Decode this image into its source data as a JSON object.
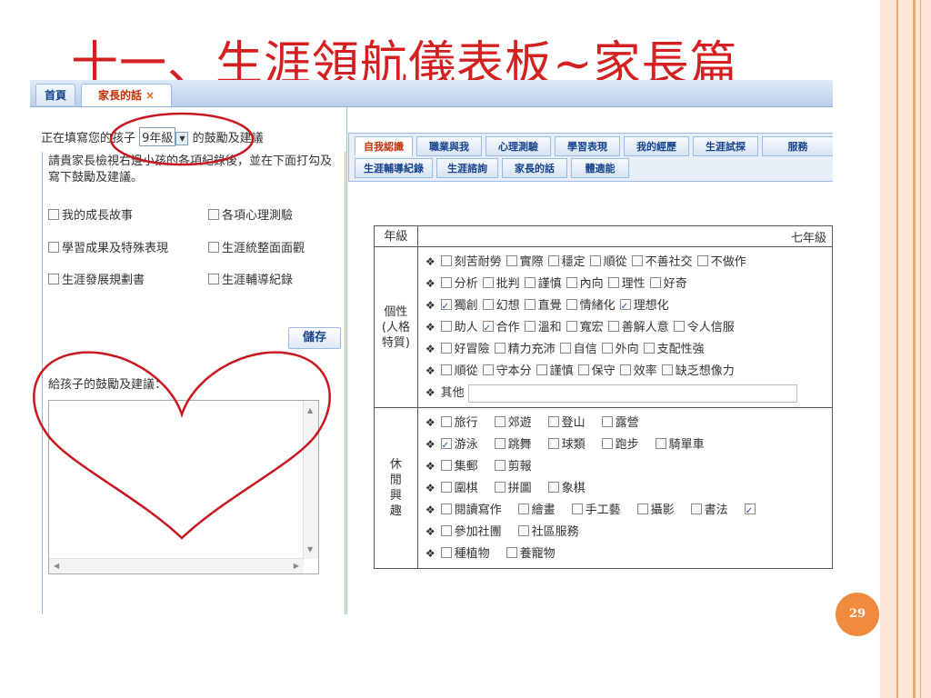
{
  "slide": {
    "title": "十一、生涯領航儀表板~家長篇",
    "page_number": "29"
  },
  "top_tabs": [
    {
      "label": "首頁",
      "active": false
    },
    {
      "label": "家長的話",
      "active": true,
      "close": "×"
    }
  ],
  "left": {
    "prefix": "正在填寫您的孩子",
    "grade": "9年級",
    "suffix": "的鼓勵及建議",
    "intro": "請貴家長檢視右邊小孩的各項紀錄後，並在下面打勾及寫下鼓勵及建議。",
    "options": [
      {
        "label": "我的成長故事"
      },
      {
        "label": "各項心理測驗"
      },
      {
        "label": "學習成果及特殊表現"
      },
      {
        "label": "生涯統整面面觀"
      },
      {
        "label": "生涯發展規劃書"
      },
      {
        "label": "生涯輔導紀錄"
      }
    ],
    "save_label": "儲存",
    "advice_label": "給孩子的鼓勵及建議："
  },
  "right": {
    "tabs_row1": [
      "自我認識",
      "職業與我",
      "心理測驗",
      "學習表現",
      "我的經歷",
      "生涯試探",
      "服務"
    ],
    "tabs_row2": [
      "生涯輔導紀錄",
      "生涯諮詢",
      "家長的話",
      "體適能"
    ],
    "table": {
      "grade_header": "年級",
      "grade_value": "七年級",
      "personality_label": "個性\n(人格\n特質)",
      "personality_rows": [
        [
          {
            "label": "刻苦耐勞",
            "checked": false
          },
          {
            "label": "實際",
            "checked": false
          },
          {
            "label": "穩定",
            "checked": false
          },
          {
            "label": "順從",
            "checked": false
          },
          {
            "label": "不善社交",
            "checked": false
          },
          {
            "label": "不做作",
            "checked": false
          }
        ],
        [
          {
            "label": "分析",
            "checked": false
          },
          {
            "label": "批判",
            "checked": false
          },
          {
            "label": "謹慎",
            "checked": false
          },
          {
            "label": "內向",
            "checked": false
          },
          {
            "label": "理性",
            "checked": false
          },
          {
            "label": "好奇",
            "checked": false
          }
        ],
        [
          {
            "label": "獨創",
            "checked": true
          },
          {
            "label": "幻想",
            "checked": false
          },
          {
            "label": "直覺",
            "checked": false
          },
          {
            "label": "情緒化",
            "checked": false
          },
          {
            "label": "理想化",
            "checked": true
          }
        ],
        [
          {
            "label": "助人",
            "checked": false
          },
          {
            "label": "合作",
            "checked": true
          },
          {
            "label": "溫和",
            "checked": false
          },
          {
            "label": "寬宏",
            "checked": false
          },
          {
            "label": "善解人意",
            "checked": false
          },
          {
            "label": "令人信服",
            "checked": false
          }
        ],
        [
          {
            "label": "好冒險",
            "checked": false
          },
          {
            "label": "精力充沛",
            "checked": false
          },
          {
            "label": "自信",
            "checked": false
          },
          {
            "label": "外向",
            "checked": false
          },
          {
            "label": "支配性強",
            "checked": false
          }
        ],
        [
          {
            "label": "順從",
            "checked": false
          },
          {
            "label": "守本分",
            "checked": false
          },
          {
            "label": "謹慎",
            "checked": false
          },
          {
            "label": "保守",
            "checked": false
          },
          {
            "label": "效率",
            "checked": false
          },
          {
            "label": "缺乏想像力",
            "checked": false
          }
        ]
      ],
      "other_label": "其他",
      "leisure_label": "休\n閒\n興\n趣",
      "leisure_rows": [
        [
          {
            "label": "旅行",
            "checked": false
          },
          {
            "label": "郊遊",
            "checked": false
          },
          {
            "label": "登山",
            "checked": false
          },
          {
            "label": "露營",
            "checked": false
          }
        ],
        [
          {
            "label": "游泳",
            "checked": true
          },
          {
            "label": "跳舞",
            "checked": false
          },
          {
            "label": "球類",
            "checked": false
          },
          {
            "label": "跑步",
            "checked": false
          },
          {
            "label": "騎單車",
            "checked": false
          }
        ],
        [
          {
            "label": "集郵",
            "checked": false
          },
          {
            "label": "剪報",
            "checked": false
          }
        ],
        [
          {
            "label": "圍棋",
            "checked": false
          },
          {
            "label": "拼圖",
            "checked": false
          },
          {
            "label": "象棋",
            "checked": false
          }
        ],
        [
          {
            "label": "閱讀寫作",
            "checked": false
          },
          {
            "label": "繪畫",
            "checked": false
          },
          {
            "label": "手工藝",
            "checked": false
          },
          {
            "label": "攝影",
            "checked": false
          },
          {
            "label": "書法",
            "checked": false
          },
          {
            "label": "",
            "checked": true
          }
        ],
        [
          {
            "label": "參加社團",
            "checked": false
          },
          {
            "label": "社區服務",
            "checked": false
          }
        ],
        [
          {
            "label": "種植物",
            "checked": false
          },
          {
            "label": "養寵物",
            "checked": false
          }
        ]
      ]
    }
  },
  "colors": {
    "title_red": "#d42020",
    "annotation_red": "#c8171e",
    "tab_blue": "#15428b",
    "badge_orange": "#f08a3c"
  }
}
